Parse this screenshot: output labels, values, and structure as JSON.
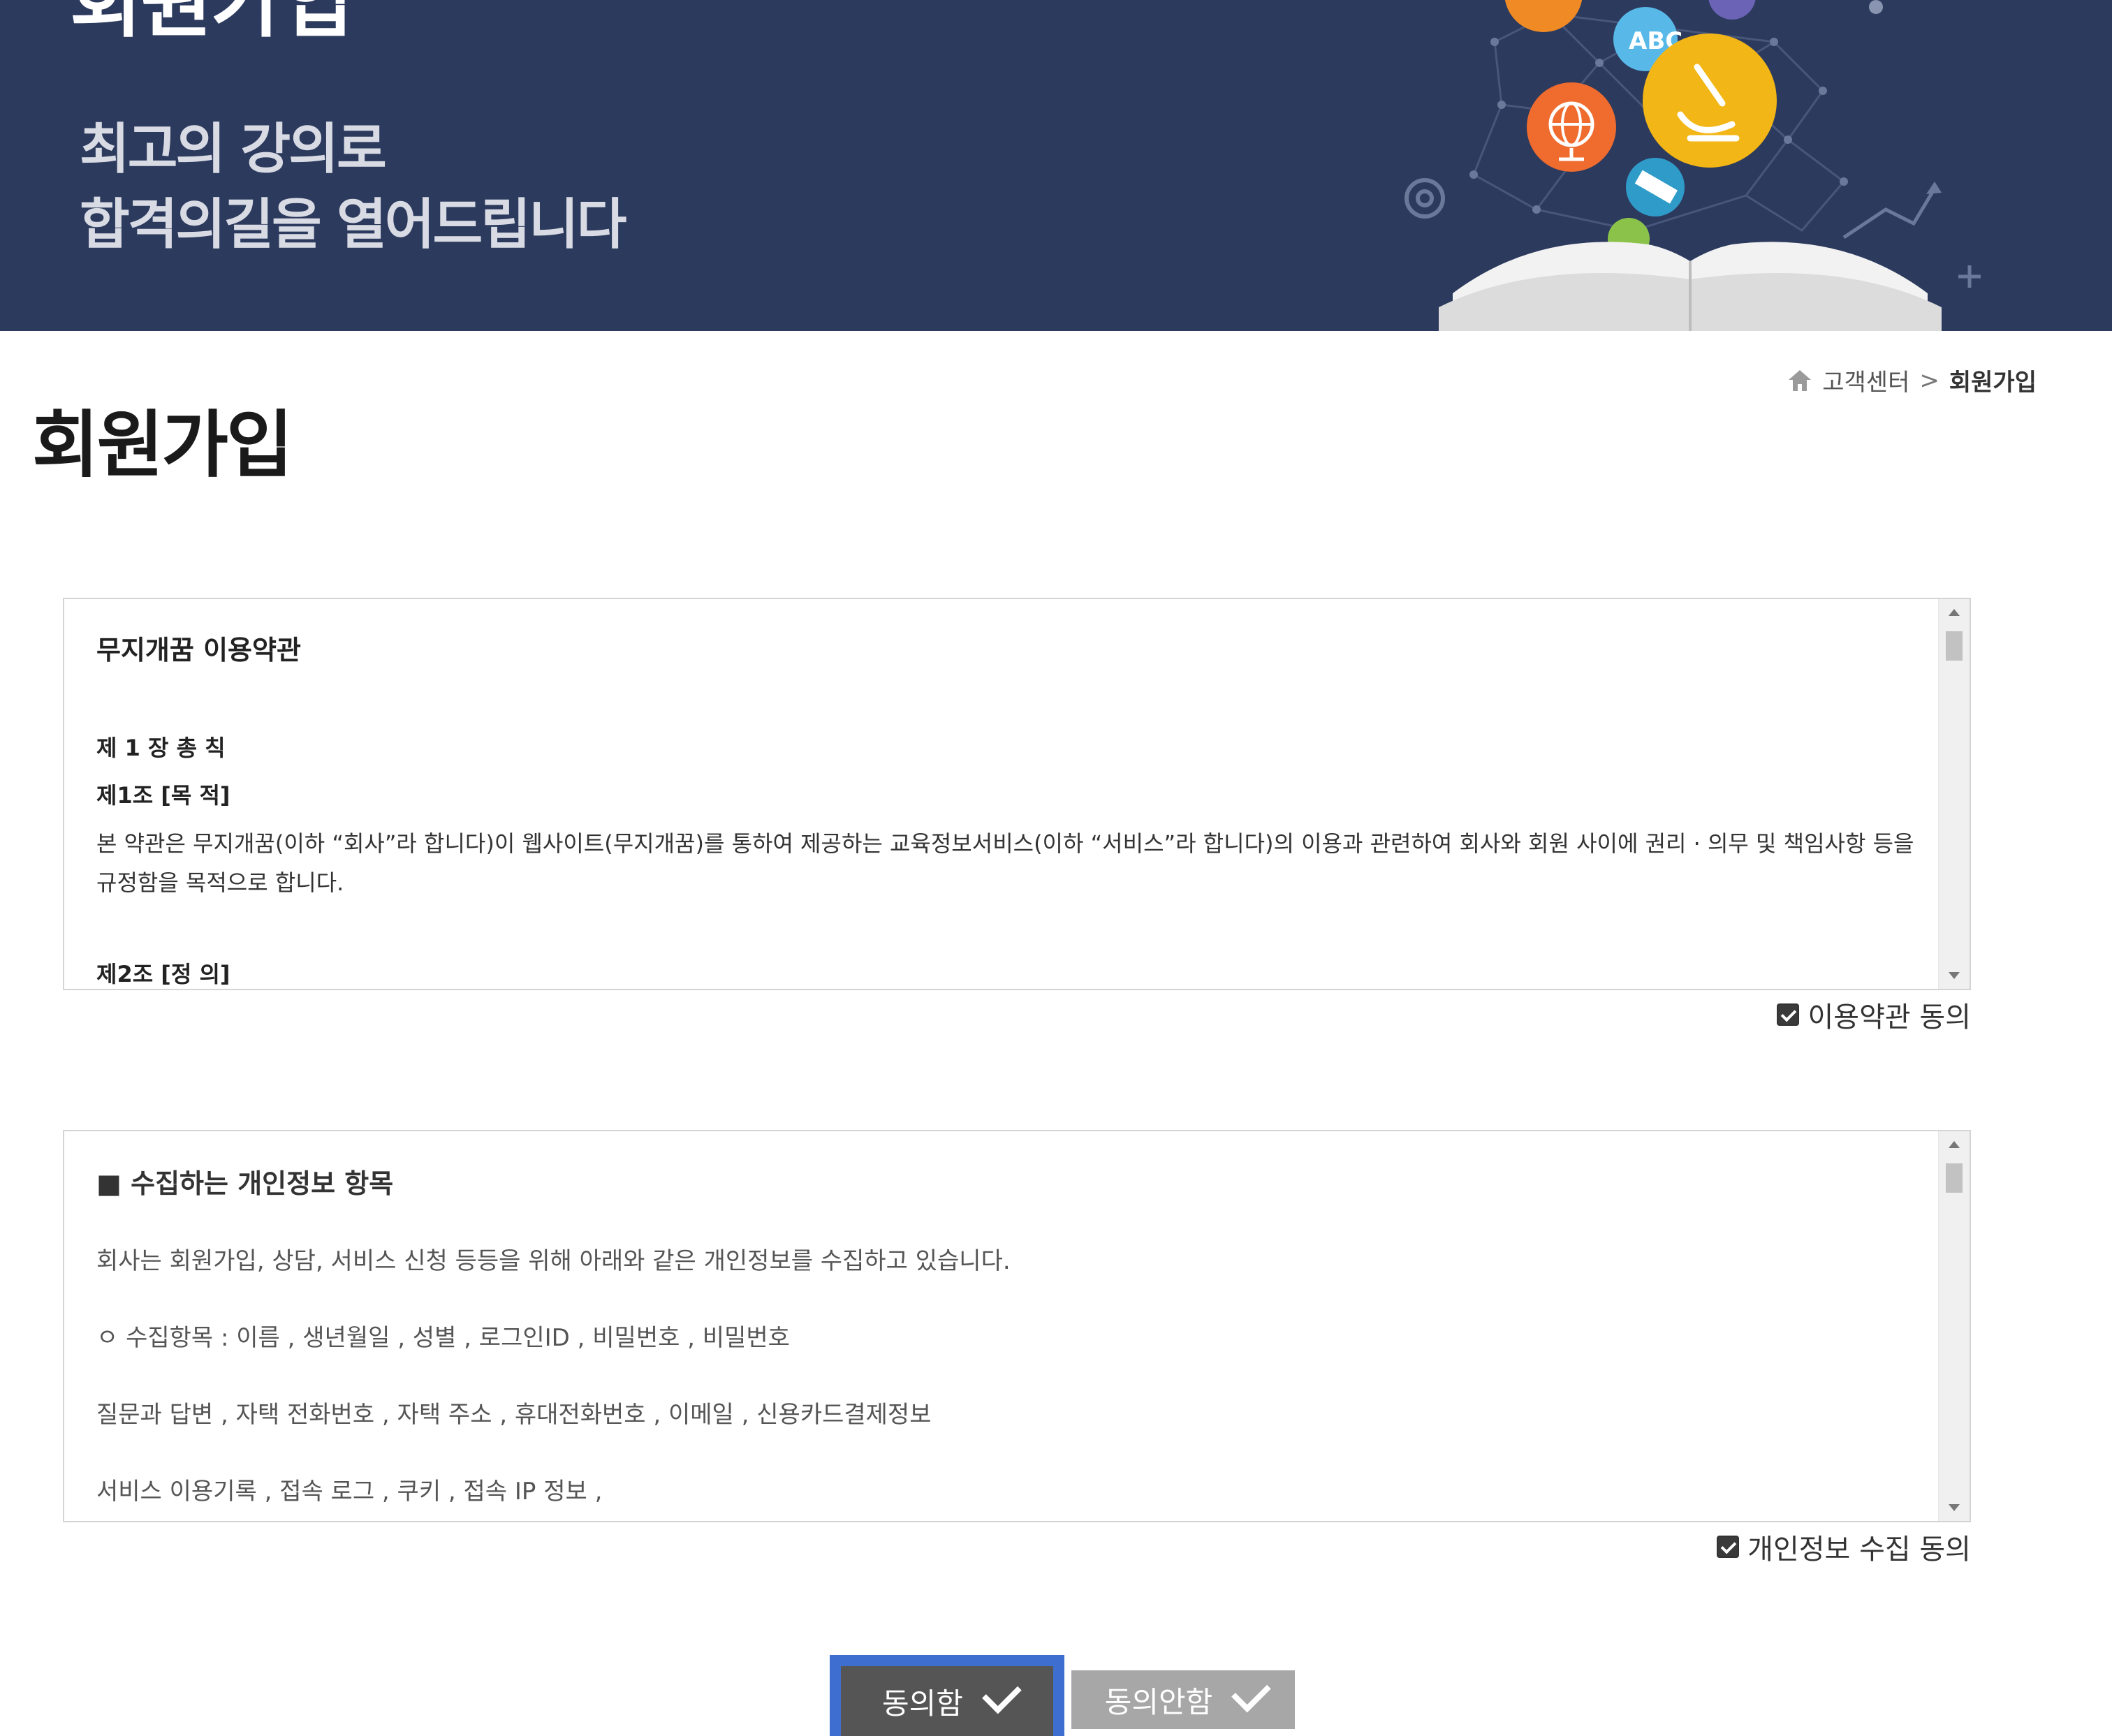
{
  "banner": {
    "title": "회원가입",
    "subtitle_line1": "최고의 강의로",
    "subtitle_line2": "합격의길을 열어드립니다"
  },
  "breadcrumb": {
    "home_icon": "home-icon",
    "parent": "고객센터",
    "separator": ">",
    "current": "회원가입"
  },
  "page_title": "회원가입",
  "terms": {
    "title": "무지개꿈 이용약관",
    "chapter": "제 1 장 총 칙",
    "article1_title": "제1조 [목 적]",
    "article1_body": "본 약관은 무지개꿈(이하 “회사”라 합니다)이 웹사이트(무지개꿈)를 통하여 제공하는 교육정보서비스(이하 “서비스”라 합니다)의 이용과 관련하여 회사와 회원 사이에 권리 · 의무 및 책임사항 등을 규정함을 목적으로 합니다.",
    "article2_title": "제2조 [정 의]",
    "agree_label": "이용약관 동의",
    "agree_checked": true
  },
  "privacy": {
    "title": "■ 수집하는 개인정보 항목",
    "line1": "회사는 회원가입, 상담, 서비스 신청 등등을 위해 아래와 같은 개인정보를 수집하고 있습니다.",
    "line2": "ㅇ 수집항목 : 이름 , 생년월일 , 성별 , 로그인ID , 비밀번호 , 비밀번호",
    "line3": "질문과 답변 , 자택 전화번호 , 자택 주소 , 휴대전화번호 , 이메일 , 신용카드결제정보",
    "line4": "서비스 이용기록 , 접속 로그 , 쿠키 , 접속 IP 정보 ,",
    "agree_label": "개인정보 수집 동의",
    "agree_checked": true
  },
  "buttons": {
    "agree": "동의함",
    "disagree": "동의안함"
  },
  "colors": {
    "banner_bg": "#2c3a5e",
    "agree_btn": "#555555",
    "agree_focus": "#3e6fd0",
    "disagree_btn": "#a7a7a7"
  }
}
